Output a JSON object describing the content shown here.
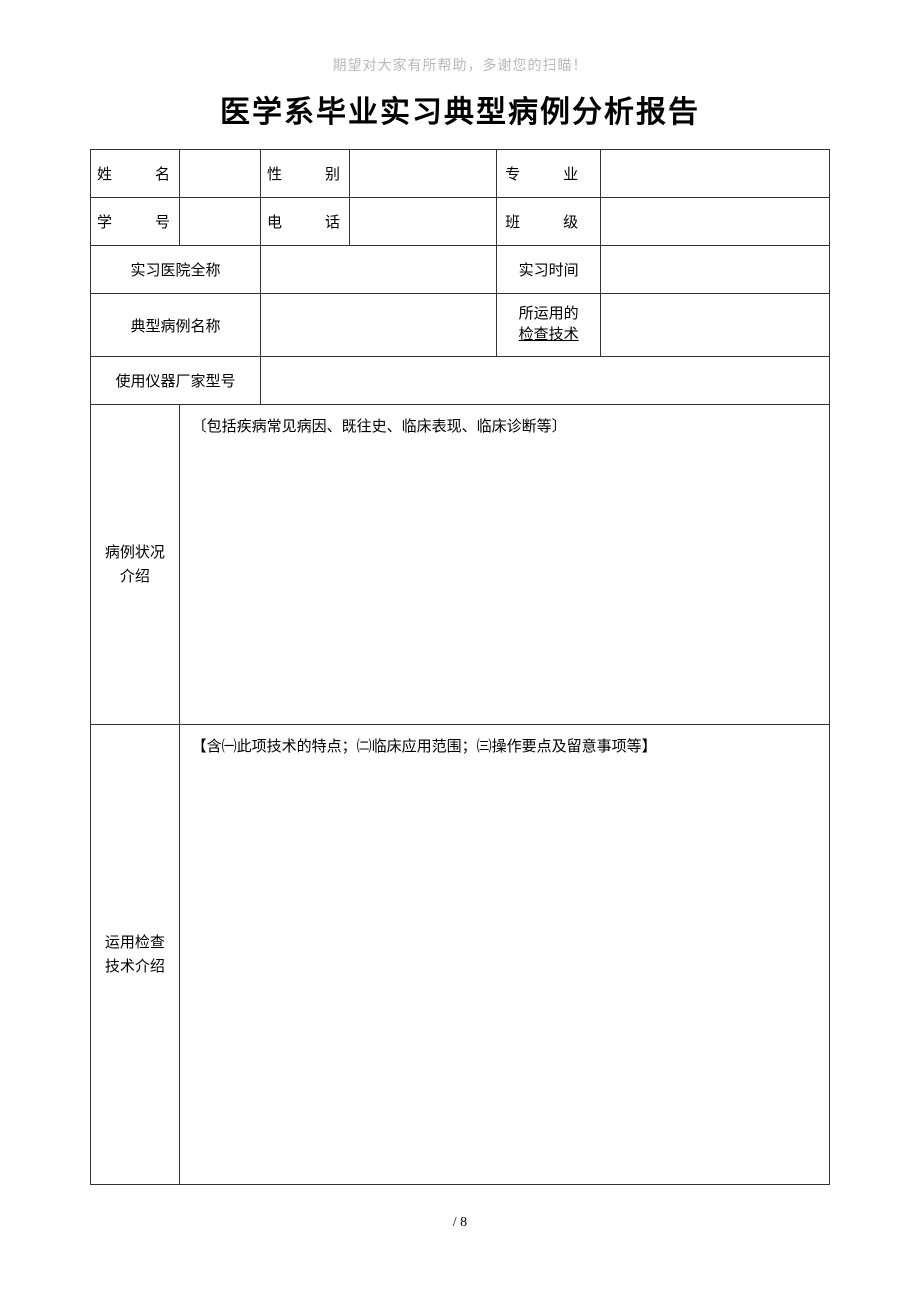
{
  "header_note": "期望对大家有所帮助，多谢您的扫瞄！",
  "title": "医学系毕业实习典型病例分析报告",
  "labels": {
    "name": "姓　名",
    "gender": "性　别",
    "major": "专　业",
    "student_id": "学　号",
    "phone": "电　话",
    "class": "班　级",
    "hospital": "实习医院全称",
    "intern_time": "实习时间",
    "case_name": "典型病例名称",
    "tech_used_line1": "所运用的",
    "tech_used_line2": "检查技术",
    "instrument": "使用仪器厂家型号",
    "case_intro_line1": "病例状况",
    "case_intro_line2": "介绍",
    "tech_intro_line1": "运用检查",
    "tech_intro_line2": "技术介绍"
  },
  "values": {
    "name": "",
    "gender": "",
    "major": "",
    "student_id": "",
    "phone": "",
    "class": "",
    "hospital": "",
    "intern_time": "",
    "case_name": "",
    "tech_used": "",
    "instrument": ""
  },
  "content": {
    "case_intro_hint": "〔包括疾病常见病因、既往史、临床表现、临床诊断等〕",
    "tech_intro_hint": "【含㈠此项技术的特点；㈡临床应用范围；㈢操作要点及留意事项等】"
  },
  "page_number": "/ 8"
}
